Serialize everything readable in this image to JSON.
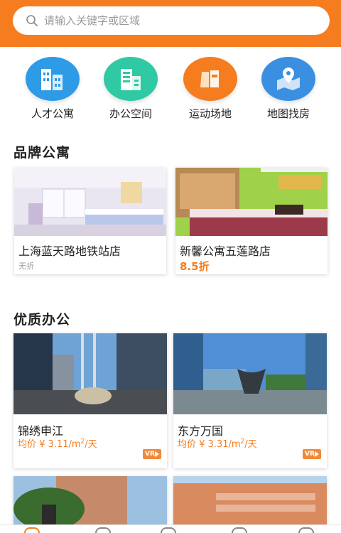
{
  "search": {
    "placeholder": "请输入关键字或区域"
  },
  "categories": [
    {
      "label": "人才公寓",
      "icon": "apartment-building-icon",
      "color": "#2e9be6"
    },
    {
      "label": "办公空间",
      "icon": "office-building-icon",
      "color": "#2fc9a3"
    },
    {
      "label": "运动场地",
      "icon": "sports-venue-icon",
      "color": "#f57d1f"
    },
    {
      "label": "地图找房",
      "icon": "map-pin-icon",
      "color": "#3b8fe0"
    }
  ],
  "brand": {
    "title": "品牌公寓",
    "items": [
      {
        "name": "上海蓝天路地铁站店",
        "sub": "无折"
      },
      {
        "name": "新馨公寓五莲路店",
        "discount": "8.5折"
      }
    ]
  },
  "office": {
    "title": "优质办公",
    "items": [
      {
        "name": "锦绣申江",
        "price_prefix": "均价 ¥ 3.11/m",
        "price_sup": "2",
        "price_suffix": "/天",
        "badge": "VR"
      },
      {
        "name": "东方万国",
        "price_prefix": "均价 ¥ 3.31/m",
        "price_sup": "2",
        "price_suffix": "/天",
        "badge": "VR"
      }
    ]
  },
  "colors": {
    "accent": "#f57d1f"
  }
}
